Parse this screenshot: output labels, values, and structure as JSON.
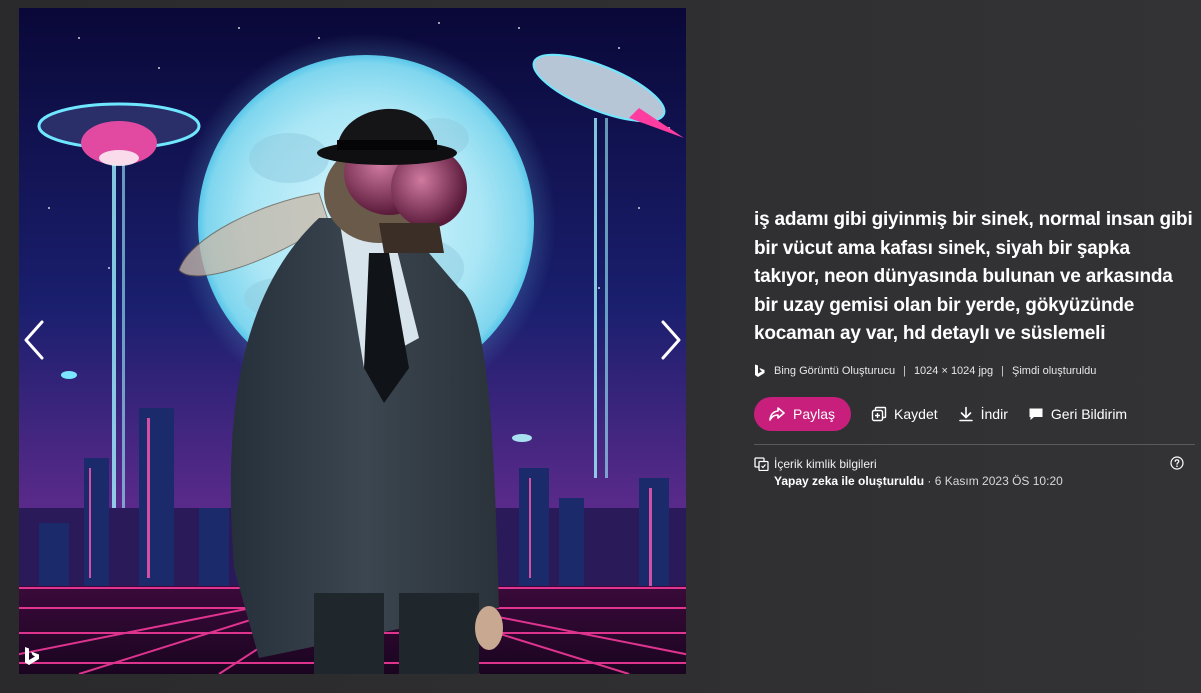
{
  "image": {
    "subject": "fly-in-suit-neon-city",
    "prev_icon": "chevron-left-icon",
    "next_icon": "chevron-right-icon",
    "watermark_icon": "bing-logo-icon"
  },
  "details": {
    "prompt": "iş adamı gibi giyinmiş bir sinek, normal insan gibi bir vücut ama kafası sinek, siyah bir şapka takıyor, neon dünyasında bulunan ve arkasında bir uzay gemisi olan bir yerde, gökyüzünde kocaman ay var, hd detaylı ve süslemeli",
    "source": "Bing Görüntü Oluşturucu",
    "dimensions": "1024 × 1024 jpg",
    "created": "Şimdi oluşturuldu"
  },
  "actions": {
    "share": "Paylaş",
    "save": "Kaydet",
    "download": "İndir",
    "feedback": "Geri Bildirim"
  },
  "credentials": {
    "title": "İçerik kimlik bilgileri",
    "ai_label": "Yapay zeka ile oluşturuldu",
    "date": " · 6 Kasım 2023 ÖS 10:20"
  },
  "colors": {
    "accent": "#c81e7c",
    "background": "#2b2b2d"
  }
}
